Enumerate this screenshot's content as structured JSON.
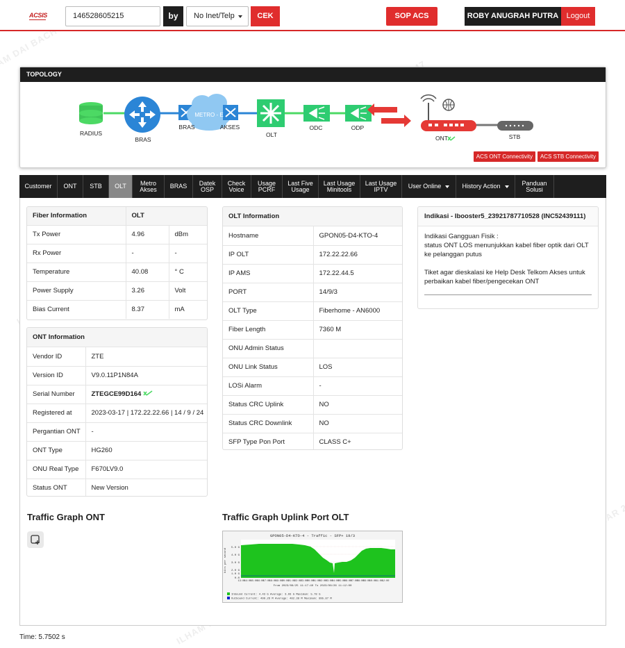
{
  "header": {
    "logo": "ACSIS",
    "search_value": "146528605215",
    "by_label": "by",
    "select_value": "No Inet/Telp",
    "cek_label": "CEK",
    "sop_label": "SOP ACS",
    "user_name": "ROBY ANUGRAH PUTRA",
    "logout_label": "Logout"
  },
  "topology": {
    "title": "TOPOLOGY",
    "nodes": {
      "radius": "RADIUS",
      "bras1": "BRAS",
      "bras2": "BRAS",
      "metro": "METRO - E",
      "akses": "AKSES",
      "olt": "OLT",
      "odc": "ODC",
      "odp": "ODP",
      "ont": "ONT",
      "stb": "STB"
    },
    "links": [
      "ACS ONT Connectivity",
      "ACS STB Connectivity"
    ],
    "colors": {
      "bras": "#2b85d6",
      "olt": "#2ecc71",
      "line_green": "#4cd964",
      "line_blue": "#2b85d6",
      "arrow_red": "#e53935",
      "ont_red": "#e53935"
    }
  },
  "nav": {
    "items": [
      "Customer",
      "ONT",
      "STB",
      "OLT",
      "Metro Akses",
      "BRAS",
      "Datek OSP",
      "Check Voice",
      "Usage PCRF",
      "Last Five Usage",
      "Last Usage Minitools",
      "Last Usage IPTV",
      "User Online",
      "History Action",
      "Panduan Solusi"
    ],
    "active": "OLT"
  },
  "fiber": {
    "header": [
      "Fiber Information",
      "OLT"
    ],
    "rows": [
      [
        "Tx Power",
        "4.96",
        "dBm"
      ],
      [
        "Rx Power",
        "-",
        "-"
      ],
      [
        "Temperature",
        "40.08",
        "° C"
      ],
      [
        "Power Supply",
        "3.26",
        "Volt"
      ],
      [
        "Bias Current",
        "8.37",
        "mA"
      ]
    ]
  },
  "ont_info": {
    "title": "ONT Information",
    "rows": [
      [
        "Vendor ID",
        "ZTE"
      ],
      [
        "Version ID",
        "V9.0.11P1N84A"
      ],
      [
        "Serial Number",
        "ZTEGCE99D164"
      ],
      [
        "Registered at",
        "2023-03-17 | 172.22.22.66 | 14 / 9 / 24"
      ],
      [
        "Pergantian ONT",
        "-"
      ],
      [
        "ONT Type",
        "HG260"
      ],
      [
        "ONU Real Type",
        "F670LV9.0"
      ],
      [
        "Status ONT",
        "New Version"
      ]
    ]
  },
  "olt_info": {
    "title": "OLT Information",
    "rows": [
      [
        "Hostname",
        "GPON05-D4-KTO-4"
      ],
      [
        "IP OLT",
        "172.22.22.66"
      ],
      [
        "IP AMS",
        "172.22.44.5"
      ],
      [
        "PORT",
        "14/9/3"
      ],
      [
        "OLT Type",
        "Fiberhome - AN6000"
      ],
      [
        "Fiber Length",
        "7360 M"
      ],
      [
        "ONU Admin Status",
        ""
      ],
      [
        "ONU Link Status",
        "LOS"
      ],
      [
        "LOSi Alarm",
        "-"
      ],
      [
        "Status CRC Uplink",
        "NO"
      ],
      [
        "Status CRC Downlink",
        "NO"
      ],
      [
        "SFP Type Pon Port",
        "CLASS C+"
      ]
    ]
  },
  "indikasi": {
    "title": "Indikasi - Ibooster5_23921787710528 (INC52439111)",
    "line1": "Indikasi Gangguan Fisik :",
    "line2": "status ONT LOS menunjukkan kabel fiber optik dari OLT ke pelanggan putus",
    "line3": "Tiket agar dieskalasi ke Help Desk Telkom Akses untuk perbaikan kabel fiber/pengecekan ONT"
  },
  "graphs": {
    "ont_title": "Traffic Graph ONT",
    "olt_title": "Traffic Graph Uplink Port OLT",
    "olt_graph_title": "GPON05-D4-KTO-4 - Traffic - SFP+ 19/3",
    "y_axis_label": "bits per second",
    "y_ticks": [
      "5.0 G",
      "4.0 G",
      "3.0 G",
      "2.0 G",
      "1.0 G",
      "0.0"
    ],
    "x_ticks": [
      "13:00",
      "14:00",
      "15:00",
      "16:00",
      "17:00",
      "18:00",
      "19:00",
      "20:00",
      "21:00",
      "22:00",
      "23:00",
      "00:00",
      "01:00",
      "02:00",
      "03:00",
      "04:00",
      "05:00",
      "06:00",
      "07:00",
      "08:00",
      "09:00",
      "10:00",
      "11:00",
      "12:00"
    ],
    "range_text": "From 2023/08/25 11:17:40 To 2023/08/26 11:12:00",
    "legend_in": "Inbound    Current:   4.43 G   Average:   3.93 G   Maximum:   5.78 G",
    "legend_out": "Outbound   Current:   499.26 M   Average:   482.38 M   Maximum:   895.87 M"
  },
  "footer": {
    "time": "Time: 5.7502 s"
  },
  "watermark": "ILHAM DAI BACHTIAR 25286947"
}
